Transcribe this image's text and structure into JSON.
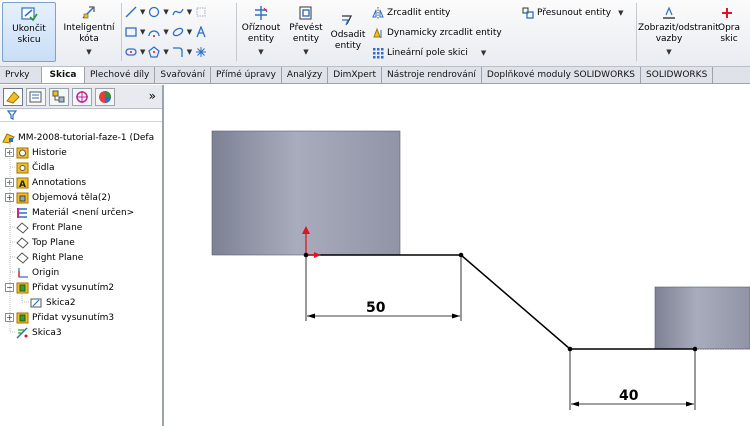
{
  "ribbon": {
    "exit_sketch": "Ukončit skicu",
    "smart_dimension": "Inteligentní kóta",
    "trim_entities": "Oříznout entity",
    "convert_entities": "Převést entity",
    "offset_entities": "Odsadit entity",
    "mirror_entities": "Zrcadlit entity",
    "dynamic_mirror": "Dynamicky zrcadlit entity",
    "linear_pattern": "Lineární pole skici",
    "move_entities": "Přesunout entity",
    "display_relations": "Zobrazit/odstranit vazby",
    "repair_sketch": "Opra skic"
  },
  "tabs": [
    "Prvky",
    "Skica",
    "Plechové díly",
    "Svařování",
    "Přímé úpravy",
    "Analýzy",
    "DimXpert",
    "Nástroje rendrování",
    "Doplňkové moduly SOLIDWORKS",
    "SOLIDWORKS"
  ],
  "active_tab": "Skica",
  "tree": {
    "root": "MM-2008-tutorial-faze-1  (Defa",
    "items": [
      {
        "label": "Historie",
        "icon": "history-icon",
        "expandable": true
      },
      {
        "label": "Čidla",
        "icon": "sensors-icon",
        "expandable": false
      },
      {
        "label": "Annotations",
        "icon": "annotations-icon",
        "expandable": true
      },
      {
        "label": "Objemová těla(2)",
        "icon": "solid-bodies-icon",
        "expandable": true
      },
      {
        "label": "Materiál <není určen>",
        "icon": "material-icon",
        "expandable": false
      },
      {
        "label": "Front Plane",
        "icon": "plane-icon",
        "expandable": false
      },
      {
        "label": "Top Plane",
        "icon": "plane-icon",
        "expandable": false
      },
      {
        "label": "Right Plane",
        "icon": "plane-icon",
        "expandable": false
      },
      {
        "label": "Origin",
        "icon": "origin-icon",
        "expandable": false
      },
      {
        "label": "Přidat vysunutím2",
        "icon": "extrude-icon",
        "expandable": true,
        "expanded": true
      },
      {
        "label": "Skica2",
        "icon": "sketch-icon",
        "expandable": false,
        "child": true
      },
      {
        "label": "Přidat vysunutím3",
        "icon": "extrude-icon",
        "expandable": true
      },
      {
        "label": "Skica3",
        "icon": "active-sketch-icon",
        "expandable": false
      }
    ]
  },
  "dimensions": {
    "left": "50",
    "right": "40"
  },
  "colors": {
    "accent": "#2e6fc5",
    "origin_red": "#e0141e",
    "body_shade": "#8e93a4"
  }
}
